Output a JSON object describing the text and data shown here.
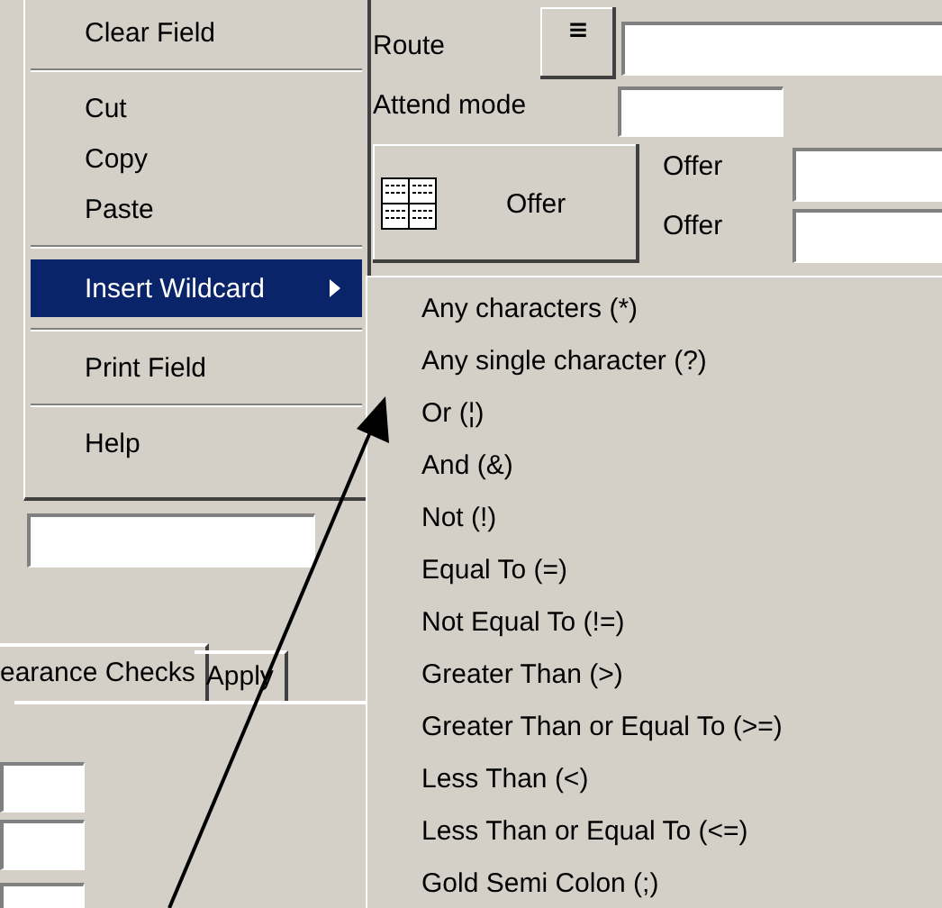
{
  "form": {
    "route_label": "Route",
    "route_button": "≡",
    "attend_label": "Attend mode",
    "offer_button": "Offer",
    "offer_labels": [
      "Offer",
      "Offer"
    ],
    "tabs": [
      {
        "label": "earance Checks",
        "selected": true
      },
      {
        "label": "Apply",
        "selected": false
      }
    ]
  },
  "context_menu": {
    "items": [
      {
        "kind": "item",
        "label": "Clear Field",
        "selected": false
      },
      {
        "kind": "separator"
      },
      {
        "kind": "item",
        "label": "Cut",
        "selected": false
      },
      {
        "kind": "item",
        "label": "Copy",
        "selected": false
      },
      {
        "kind": "item",
        "label": "Paste",
        "selected": false
      },
      {
        "kind": "separator"
      },
      {
        "kind": "submenu",
        "label": "Insert Wildcard",
        "selected": true
      },
      {
        "kind": "separator"
      },
      {
        "kind": "item",
        "label": "Print Field",
        "selected": false
      },
      {
        "kind": "separator"
      },
      {
        "kind": "item",
        "label": "Help",
        "selected": false
      }
    ]
  },
  "submenu": {
    "items": [
      "Any characters (*)",
      "Any single character (?)",
      "Or (¦)",
      "And (&)",
      "Not (!)",
      "Equal To (=)",
      "Not Equal To (!=)",
      "Greater Than (>)",
      "Greater Than or Equal To (>=)",
      "Less Than (<)",
      "Less Than or Equal To (<=)",
      "Gold Semi Colon (;)"
    ]
  }
}
